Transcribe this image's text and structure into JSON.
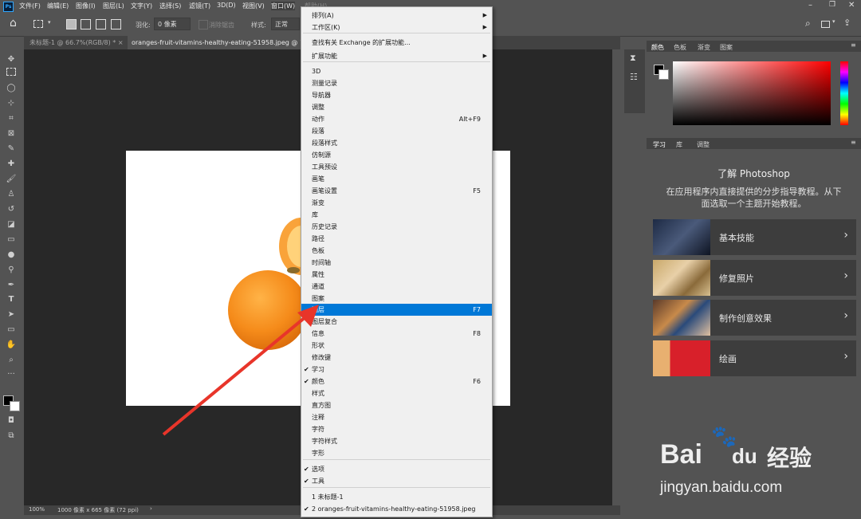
{
  "menubar": {
    "items": [
      "文件(F)",
      "编辑(E)",
      "图像(I)",
      "图层(L)",
      "文字(Y)",
      "选择(S)",
      "滤镜(T)",
      "3D(D)",
      "视图(V)",
      "窗口(W)",
      "帮助(H)"
    ],
    "logo": "Ps"
  },
  "options": {
    "feather_label": "羽化:",
    "feather_value": "0 像素",
    "antialias_label": "消除锯齿",
    "style_label": "样式:",
    "style_value": "正常"
  },
  "tabs": [
    {
      "label": "未标题-1 @ 66.7%(RGB/8) *",
      "active": false
    },
    {
      "label": "oranges-fruit-vitamins-healthy-eating-51958.jpeg @ 1",
      "active": true
    }
  ],
  "status": {
    "zoom": "100%",
    "size": "1000 像素 x 665 像素 (72 ppi)"
  },
  "panels": {
    "color_tabs": [
      "颜色",
      "色板",
      "渐变",
      "图案"
    ],
    "learn_tabs": [
      "学习",
      "库",
      "调整"
    ],
    "learn_title": "了解 Photoshop",
    "learn_desc_1": "在应用程序内直接提供的分步指导教程。从下",
    "learn_desc_2": "面选取一个主题开始教程。",
    "cards": [
      "基本技能",
      "修复照片",
      "制作创意效果",
      "绘画"
    ]
  },
  "window_menu": {
    "items": [
      {
        "label": "排列(A)",
        "shortcut": "",
        "submenu": true,
        "checked": false
      },
      {
        "label": "工作区(K)",
        "shortcut": "",
        "submenu": true,
        "checked": false
      },
      {
        "label": "查找有关 Exchange 的扩展功能...",
        "shortcut": "",
        "submenu": false,
        "checked": false
      },
      {
        "label": "扩展功能",
        "shortcut": "",
        "submenu": true,
        "checked": false
      },
      {
        "label": "3D",
        "shortcut": "",
        "submenu": false,
        "checked": false
      },
      {
        "label": "测量记录",
        "shortcut": "",
        "submenu": false,
        "checked": false
      },
      {
        "label": "导航器",
        "shortcut": "",
        "submenu": false,
        "checked": false
      },
      {
        "label": "调整",
        "shortcut": "",
        "submenu": false,
        "checked": false
      },
      {
        "label": "动作",
        "shortcut": "Alt+F9",
        "submenu": false,
        "checked": false
      },
      {
        "label": "段落",
        "shortcut": "",
        "submenu": false,
        "checked": false
      },
      {
        "label": "段落样式",
        "shortcut": "",
        "submenu": false,
        "checked": false
      },
      {
        "label": "仿制源",
        "shortcut": "",
        "submenu": false,
        "checked": false
      },
      {
        "label": "工具预设",
        "shortcut": "",
        "submenu": false,
        "checked": false
      },
      {
        "label": "画笔",
        "shortcut": "",
        "submenu": false,
        "checked": false
      },
      {
        "label": "画笔设置",
        "shortcut": "F5",
        "submenu": false,
        "checked": false
      },
      {
        "label": "渐变",
        "shortcut": "",
        "submenu": false,
        "checked": false
      },
      {
        "label": "库",
        "shortcut": "",
        "submenu": false,
        "checked": false
      },
      {
        "label": "历史记录",
        "shortcut": "",
        "submenu": false,
        "checked": false
      },
      {
        "label": "路径",
        "shortcut": "",
        "submenu": false,
        "checked": false
      },
      {
        "label": "色板",
        "shortcut": "",
        "submenu": false,
        "checked": false
      },
      {
        "label": "时间轴",
        "shortcut": "",
        "submenu": false,
        "checked": false
      },
      {
        "label": "属性",
        "shortcut": "",
        "submenu": false,
        "checked": false
      },
      {
        "label": "通道",
        "shortcut": "",
        "submenu": false,
        "checked": false
      },
      {
        "label": "图案",
        "shortcut": "",
        "submenu": false,
        "checked": false
      },
      {
        "label": "图层",
        "shortcut": "F7",
        "submenu": false,
        "checked": false,
        "highlighted": true
      },
      {
        "label": "图层复合",
        "shortcut": "",
        "submenu": false,
        "checked": false
      },
      {
        "label": "信息",
        "shortcut": "F8",
        "submenu": false,
        "checked": false
      },
      {
        "label": "形状",
        "shortcut": "",
        "submenu": false,
        "checked": false
      },
      {
        "label": "修改键",
        "shortcut": "",
        "submenu": false,
        "checked": false
      },
      {
        "label": "学习",
        "shortcut": "",
        "submenu": false,
        "checked": true
      },
      {
        "label": "颜色",
        "shortcut": "F6",
        "submenu": false,
        "checked": true
      },
      {
        "label": "样式",
        "shortcut": "",
        "submenu": false,
        "checked": false
      },
      {
        "label": "直方图",
        "shortcut": "",
        "submenu": false,
        "checked": false
      },
      {
        "label": "注释",
        "shortcut": "",
        "submenu": false,
        "checked": false
      },
      {
        "label": "字符",
        "shortcut": "",
        "submenu": false,
        "checked": false
      },
      {
        "label": "字符样式",
        "shortcut": "",
        "submenu": false,
        "checked": false
      },
      {
        "label": "字形",
        "shortcut": "",
        "submenu": false,
        "checked": false
      },
      {
        "label": "选项",
        "shortcut": "",
        "submenu": false,
        "checked": true
      },
      {
        "label": "工具",
        "shortcut": "",
        "submenu": false,
        "checked": true
      },
      {
        "label": "1 未标题-1",
        "shortcut": "",
        "submenu": false,
        "checked": false
      },
      {
        "label": "2 oranges-fruit-vitamins-healthy-eating-51958.jpeg",
        "shortcut": "",
        "submenu": false,
        "checked": true
      }
    ]
  },
  "watermark": {
    "brand": "Bai",
    "brand2": "du",
    "cn": "经验",
    "url": "jingyan.baidu.com"
  },
  "colors": {
    "accent": "#0078d7",
    "panel_bg": "#535353",
    "canvas_bg": "#282828",
    "arrow": "#e8352a"
  }
}
